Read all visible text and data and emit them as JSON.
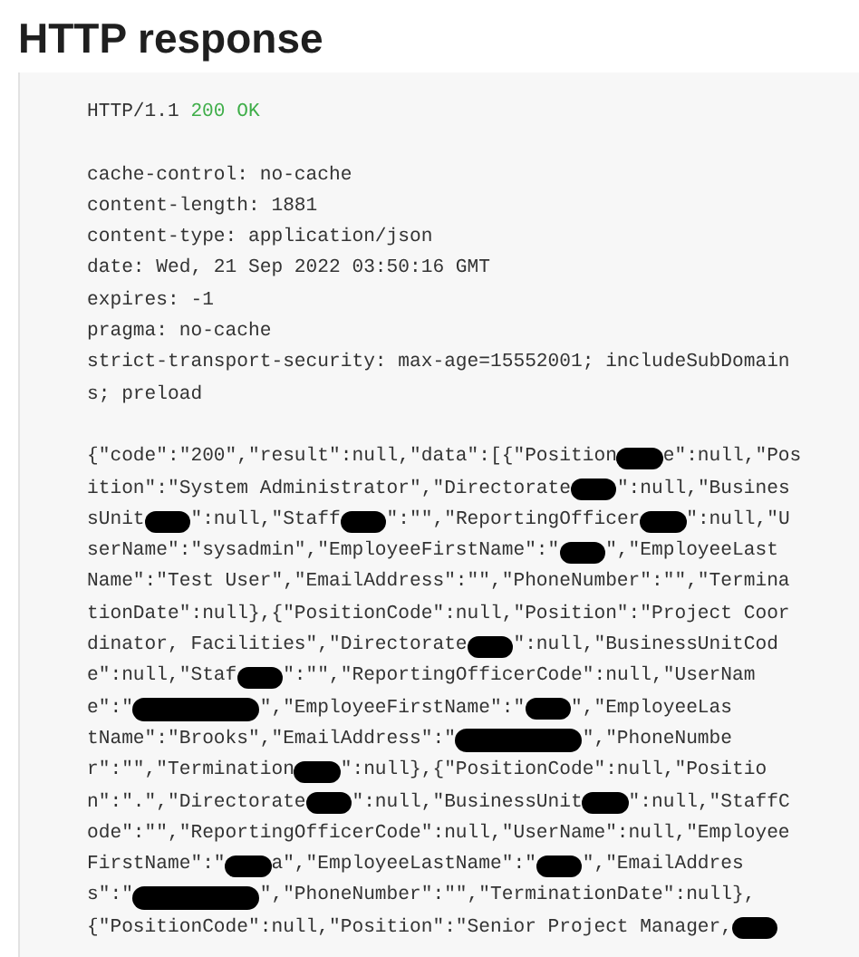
{
  "title": "HTTP response",
  "status_line": {
    "protocol": "HTTP/1.1",
    "status": "200 OK"
  },
  "headers": [
    "cache-control: no-cache",
    "content-length: 1881",
    "content-type: application/json",
    "date: Wed, 21 Sep 2022 03:50:16 GMT",
    "expires: -1",
    "pragma: no-cache",
    "strict-transport-security: max-age=15552001; includeSubDomain",
    "s; preload"
  ],
  "body_lines": [
    [
      {
        "kind": "text",
        "text": "{\"code\":\"200\",\"result\":null,\"data\":[{\"Position"
      },
      {
        "kind": "redaction"
      },
      {
        "kind": "text",
        "text": "e\":null,\"Pos"
      }
    ],
    [
      {
        "kind": "text",
        "text": "ition\":\"System Administrator\",\"Directorate"
      },
      {
        "kind": "redaction"
      },
      {
        "kind": "text",
        "text": "\":null,\"Busines"
      }
    ],
    [
      {
        "kind": "text",
        "text": "sUnit"
      },
      {
        "kind": "redaction"
      },
      {
        "kind": "text",
        "text": "\":null,\"Staff"
      },
      {
        "kind": "redaction"
      },
      {
        "kind": "text",
        "text": "\":\"\",\"ReportingOfficer"
      },
      {
        "kind": "redaction"
      },
      {
        "kind": "text",
        "text": "\":null,\"U"
      }
    ],
    [
      {
        "kind": "text",
        "text": "serName\":\"sysadmin\",\"EmployeeFirstName\":\""
      },
      {
        "kind": "redaction"
      },
      {
        "kind": "text",
        "text": "\",\"EmployeeLast"
      }
    ],
    [
      {
        "kind": "text",
        "text": "Name\":\"Test User\",\"EmailAddress\":\"\",\"PhoneNumber\":\"\",\"Termina"
      }
    ],
    [
      {
        "kind": "text",
        "text": "tionDate\":null},{\"PositionCode\":null,\"Position\":\"Project Coor"
      }
    ],
    [
      {
        "kind": "text",
        "text": "dinator, Facilities\",\"Directorate"
      },
      {
        "kind": "redaction"
      },
      {
        "kind": "text",
        "text": "\":null,\"BusinessUnitCod"
      }
    ],
    [
      {
        "kind": "text",
        "text": "e\":null,\"Staf"
      },
      {
        "kind": "redaction"
      },
      {
        "kind": "text",
        "text": "\":\"\",\"ReportingOfficerCode\":null,\"UserNam"
      }
    ],
    [
      {
        "kind": "text",
        "text": "e\":\""
      },
      {
        "kind": "redaction_wide"
      },
      {
        "kind": "text",
        "text": "\",\"EmployeeFirstName\":\""
      },
      {
        "kind": "redaction"
      },
      {
        "kind": "text",
        "text": "\",\"EmployeeLas"
      }
    ],
    [
      {
        "kind": "text",
        "text": "tName\":\"Brooks\",\"EmailAddress\":\""
      },
      {
        "kind": "redaction_wide"
      },
      {
        "kind": "text",
        "text": "\",\"PhoneNumbe"
      }
    ],
    [
      {
        "kind": "text",
        "text": "r\":\"\",\"Termination"
      },
      {
        "kind": "redaction"
      },
      {
        "kind": "text",
        "text": "\":null},{\"PositionCode\":null,\"Positio"
      }
    ],
    [
      {
        "kind": "text",
        "text": "n\":\".\",\"Directorate"
      },
      {
        "kind": "redaction"
      },
      {
        "kind": "text",
        "text": "\":null,\"BusinessUnit"
      },
      {
        "kind": "redaction"
      },
      {
        "kind": "text",
        "text": "\":null,\"StaffC"
      }
    ],
    [
      {
        "kind": "text",
        "text": "ode\":\"\",\"ReportingOfficerCode\":null,\"UserName\":null,\"Employee"
      }
    ],
    [
      {
        "kind": "text",
        "text": "FirstName\":\""
      },
      {
        "kind": "redaction"
      },
      {
        "kind": "text",
        "text": "a\",\"EmployeeLastName\":\""
      },
      {
        "kind": "redaction"
      },
      {
        "kind": "text",
        "text": "\",\"EmailAddres"
      }
    ],
    [
      {
        "kind": "text",
        "text": "s\":\""
      },
      {
        "kind": "redaction_wide"
      },
      {
        "kind": "text",
        "text": "\",\"PhoneNumber\":\"\",\"TerminationDate\":null},"
      }
    ],
    [
      {
        "kind": "text",
        "text": "{\"PositionCode\":null,\"Position\":\"Senior Project Manager,"
      },
      {
        "kind": "redaction"
      }
    ]
  ]
}
